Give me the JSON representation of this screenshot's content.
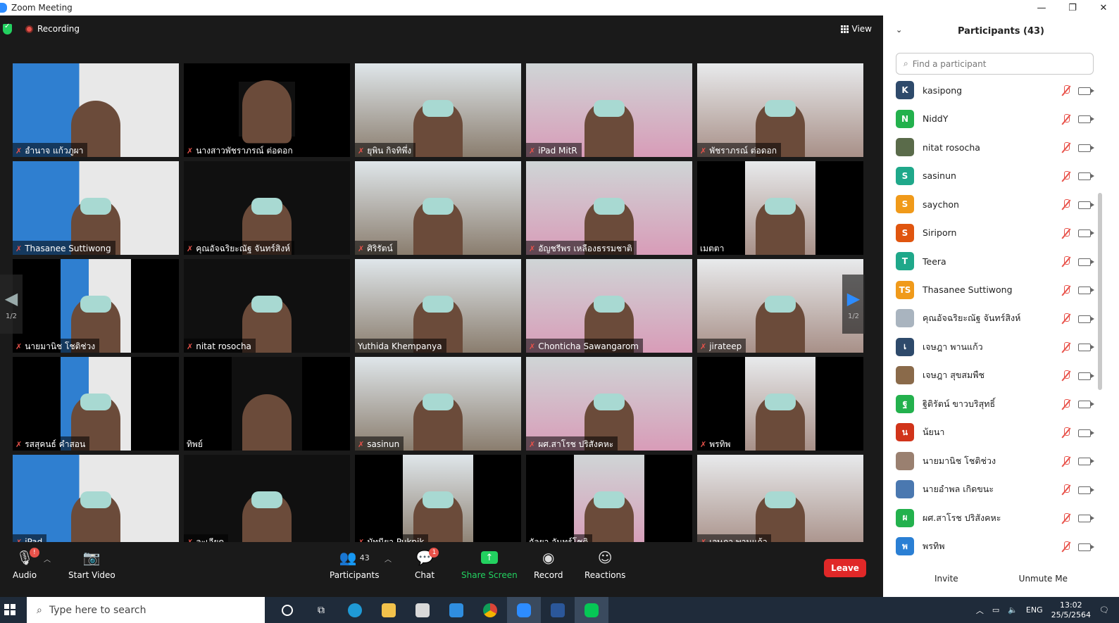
{
  "window": {
    "title": "Zoom Meeting"
  },
  "window_controls": {
    "minimize": "—",
    "restore": "❐",
    "close": "✕"
  },
  "meeting": {
    "recording_label": "Recording",
    "view_label": "View",
    "page_left": "1/2",
    "page_right": "1/2",
    "tiles": [
      {
        "name": "อำนาจ แก้วภูผา",
        "muted": true
      },
      {
        "name": "นางสาวพัชราภรณ์ ต่อดอก",
        "muted": true
      },
      {
        "name": "ยุพิน กิจทิพึ่ง",
        "muted": true
      },
      {
        "name": "iPad MitR",
        "muted": true
      },
      {
        "name": "พัชราภรณ์ ต่อดอก",
        "muted": true
      },
      {
        "name": "Thasanee Suttiwong",
        "muted": true
      },
      {
        "name": "คุณอัจฉริยะณัฐ จันทร์สิงห์",
        "muted": true
      },
      {
        "name": "ศิริรัตน์",
        "muted": true
      },
      {
        "name": "อัญชรีพร เหลืองธรรมชาติ",
        "muted": true
      },
      {
        "name": "เมตตา",
        "muted": false
      },
      {
        "name": "นายมานิช โชติช่วง",
        "muted": true
      },
      {
        "name": "nitat rosocha",
        "muted": true
      },
      {
        "name": "Yuthida Khempanya",
        "muted": false
      },
      {
        "name": "Chonticha Sawangarom",
        "muted": true
      },
      {
        "name": "jirateep",
        "muted": true
      },
      {
        "name": "รสสุคนธ์ คำสอน",
        "muted": true
      },
      {
        "name": "ทิพย์",
        "muted": false
      },
      {
        "name": "sasinun",
        "muted": true
      },
      {
        "name": "ผศ.สาโรช ปริสังคหะ",
        "muted": true
      },
      {
        "name": "พรทิพ",
        "muted": true
      },
      {
        "name": "iPad",
        "muted": true
      },
      {
        "name": "ละเอียด",
        "muted": true
      },
      {
        "name": "มัทนียา Pukpik",
        "muted": true
      },
      {
        "name": "กัลยา จันทร์โชติ",
        "muted": false
      },
      {
        "name": "เจษฎา พานแก้ว",
        "muted": true
      }
    ]
  },
  "toolbar": {
    "audio_label": "Audio",
    "audio_badge": "!",
    "video_label": "Start Video",
    "participants_label": "Participants",
    "participants_count": "43",
    "chat_label": "Chat",
    "chat_badge": "1",
    "share_label": "Share Screen",
    "record_label": "Record",
    "reactions_label": "Reactions",
    "leave_label": "Leave"
  },
  "panel": {
    "title": "Participants (43)",
    "search_placeholder": "Find a participant",
    "participants": [
      {
        "name": "kasipong",
        "initials": "K",
        "color": "#2e4a6b"
      },
      {
        "name": "NiddY",
        "initials": "N",
        "color": "#23b14d"
      },
      {
        "name": "nitat rosocha",
        "initials": "",
        "color": "#5a6b4a"
      },
      {
        "name": "sasinun",
        "initials": "S",
        "color": "#1fa88a"
      },
      {
        "name": "saychon",
        "initials": "S",
        "color": "#f09a1a"
      },
      {
        "name": "Siriporn",
        "initials": "S",
        "color": "#e0550f"
      },
      {
        "name": "Teera",
        "initials": "T",
        "color": "#1fa88a"
      },
      {
        "name": "Thasanee Suttiwong",
        "initials": "TS",
        "color": "#f09a1a"
      },
      {
        "name": "คุณอัจฉริยะณัฐ จันทร์สิงห์",
        "initials": "",
        "color": "#a9b4bf"
      },
      {
        "name": "เจษฎา พานแก้ว",
        "initials": "เ",
        "color": "#2e4a6b"
      },
      {
        "name": "เจษฎา สุขสมพืช",
        "initials": "",
        "color": "#8a6a4a"
      },
      {
        "name": "ฐิติรัตน์ ขาวบริสุทธิ์",
        "initials": "ฐ",
        "color": "#23b14d"
      },
      {
        "name": "น้ยนา",
        "initials": "น",
        "color": "#d1341a"
      },
      {
        "name": "นายมานิช โชติช่วง",
        "initials": "",
        "color": "#9a8070"
      },
      {
        "name": "นายอำพล เกิดขนะ",
        "initials": "",
        "color": "#4a78b0"
      },
      {
        "name": "ผศ.สาโรช ปริสังคหะ",
        "initials": "ผ",
        "color": "#23b14d"
      },
      {
        "name": "พรทิพ",
        "initials": "พ",
        "color": "#2a7fd4"
      }
    ],
    "invite_label": "Invite",
    "unmute_label": "Unmute Me"
  },
  "taskbar": {
    "search_placeholder": "Type here to search",
    "language": "ENG",
    "time": "13:02",
    "date": "25/5/2564"
  }
}
